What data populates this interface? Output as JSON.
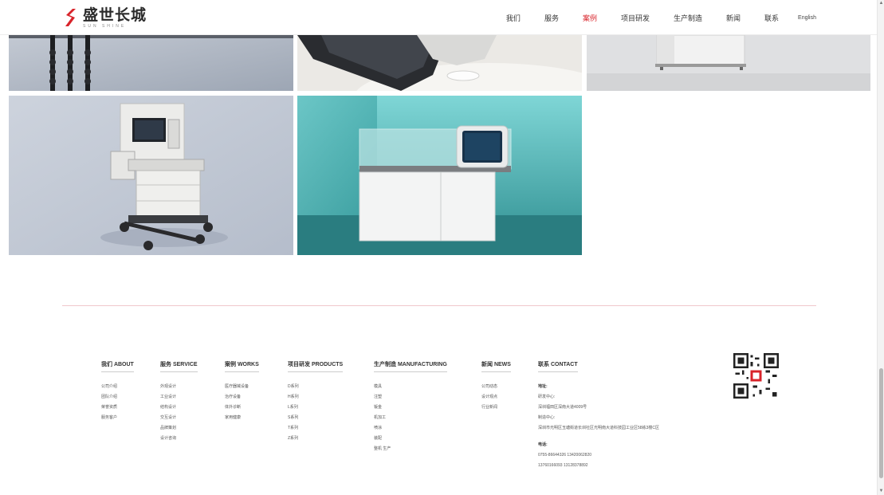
{
  "header": {
    "logo_name": "盛世长城",
    "logo_sub": "SUN SHINE",
    "nav": [
      {
        "label": "我们",
        "active": false
      },
      {
        "label": "服务",
        "active": false
      },
      {
        "label": "案例",
        "active": true
      },
      {
        "label": "项目研发",
        "active": false
      },
      {
        "label": "生产制造",
        "active": false
      },
      {
        "label": "新闻",
        "active": false
      },
      {
        "label": "联系",
        "active": false
      }
    ],
    "language": "English"
  },
  "footer": {
    "columns": [
      {
        "title": "我们 ABOUT",
        "links": [
          "公司介绍",
          "团队介绍",
          "荣誉资质",
          "服务客户"
        ]
      },
      {
        "title": "服务 SERVICE",
        "links": [
          "外观设计",
          "工业设计",
          "结构设计",
          "交互设计",
          "品牌策划",
          "设计咨询"
        ]
      },
      {
        "title": "案例 WORKS",
        "links": [
          "医疗器械设备",
          "治疗设备",
          "体外诊断",
          "家用健康"
        ]
      },
      {
        "title": "项目研发 PRODUCTS",
        "links": [
          "D系列",
          "H系列",
          "L系列",
          "S系列",
          "T系列",
          "Z系列"
        ]
      },
      {
        "title": "生产制造 MANUFACTURING",
        "links": [
          "模具",
          "注塑",
          "钣金",
          "机加工",
          "喷涂",
          "装配",
          "整机 生产"
        ]
      },
      {
        "title": "新闻 NEWS",
        "links": [
          "公司动态",
          "设计观点",
          "行业新闻"
        ]
      }
    ],
    "contact": {
      "title": "联系 CONTACT",
      "address_label": "地址:",
      "address_lines": [
        "研发中心:",
        "深圳福田区深南大道4009号",
        "制造中心:",
        "深圳市光明区玉塘街道长圳社区光明南大道科技园工业区58栋3楼C区"
      ],
      "phone_label": "电话:",
      "phone_lines": [
        "0755-86644326    13420062820",
        "13760166093    13128378892"
      ]
    }
  },
  "colors": {
    "accent": "#d8232a",
    "divider": "#f0c8cb"
  },
  "icons": {
    "qr": "qr-code-icon",
    "logo": "logo-mark-icon",
    "scroll_up": "scroll-up-arrow-icon",
    "scroll_down": "scroll-down-arrow-icon"
  }
}
